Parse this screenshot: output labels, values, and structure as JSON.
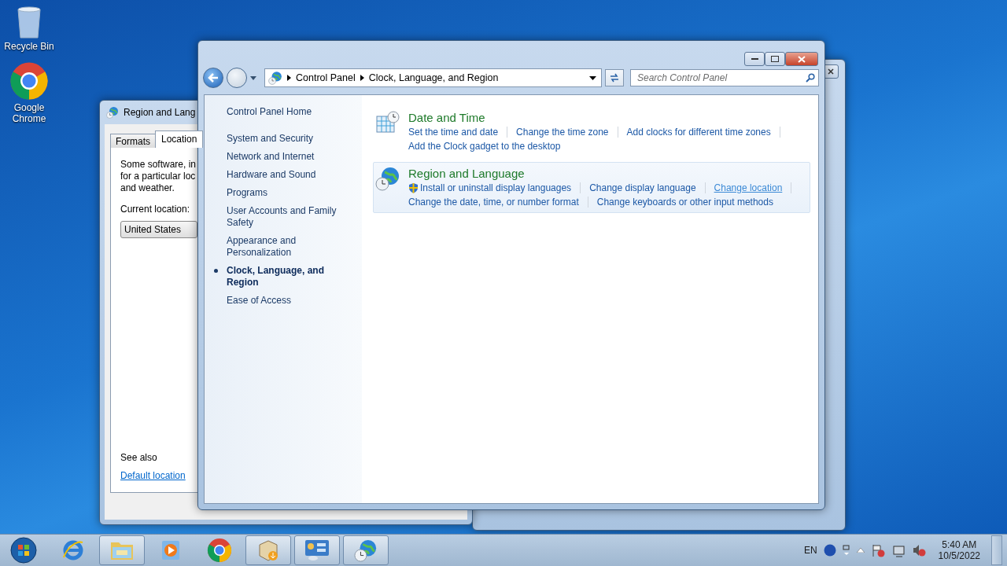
{
  "desktop_icons": [
    {
      "label": "Recycle Bin",
      "kind": "recycle"
    },
    {
      "label": "Google Chrome",
      "kind": "chrome"
    }
  ],
  "dialog": {
    "title": "Region and Lang",
    "tabs": [
      {
        "label": "Formats",
        "selected": false
      },
      {
        "label": "Location",
        "selected": true
      }
    ],
    "description_lines": [
      "Some software, in",
      "for a particular loc",
      "and weather."
    ],
    "current_location_label": "Current location:",
    "current_location": "United States",
    "see_also": "See also",
    "default_location_link": "Default location"
  },
  "window": {
    "breadcrumbs": [
      "Control Panel",
      "Clock, Language, and Region"
    ],
    "search": {
      "placeholder": "Search Control Panel"
    },
    "nav_home": "Control Panel Home",
    "nav_items": [
      {
        "label": "System and Security",
        "selected": false
      },
      {
        "label": "Network and Internet",
        "selected": false
      },
      {
        "label": "Hardware and Sound",
        "selected": false
      },
      {
        "label": "Programs",
        "selected": false
      },
      {
        "label": "User Accounts and Family Safety",
        "selected": false
      },
      {
        "label": "Appearance and Personalization",
        "selected": false
      },
      {
        "label": "Clock, Language, and Region",
        "selected": true
      },
      {
        "label": "Ease of Access",
        "selected": false
      }
    ],
    "sections": [
      {
        "title": "Date and Time",
        "kind": "clock",
        "highlighted": false,
        "link_rows": [
          [
            {
              "label": "Set the time and date",
              "shield": false,
              "hovered": false
            },
            {
              "label": "Change the time zone",
              "shield": false,
              "hovered": false
            },
            {
              "label": "Add clocks for different time zones",
              "shield": false,
              "hovered": false
            }
          ],
          [
            {
              "label": "Add the Clock gadget to the desktop",
              "shield": false,
              "hovered": false
            }
          ]
        ]
      },
      {
        "title": "Region and Language",
        "kind": "globe",
        "highlighted": true,
        "link_rows": [
          [
            {
              "label": "Install or uninstall display languages",
              "shield": true,
              "hovered": false
            },
            {
              "label": "Change display language",
              "shield": false,
              "hovered": false
            },
            {
              "label": "Change location",
              "shield": false,
              "hovered": true
            }
          ],
          [
            {
              "label": "Change the date, time, or number format",
              "shield": false,
              "hovered": false
            },
            {
              "label": "Change keyboards or other input methods",
              "shield": false,
              "hovered": false
            }
          ]
        ]
      }
    ]
  },
  "taskbar": {
    "items": [
      {
        "kind": "ie",
        "open": false
      },
      {
        "kind": "folder",
        "open": true
      },
      {
        "kind": "media",
        "open": false
      },
      {
        "kind": "chrome",
        "open": false
      },
      {
        "kind": "installer",
        "open": true
      },
      {
        "kind": "panel",
        "open": true
      },
      {
        "kind": "globe",
        "open": true
      }
    ],
    "language": "EN",
    "time": "5:40 AM",
    "date": "10/5/2022"
  }
}
